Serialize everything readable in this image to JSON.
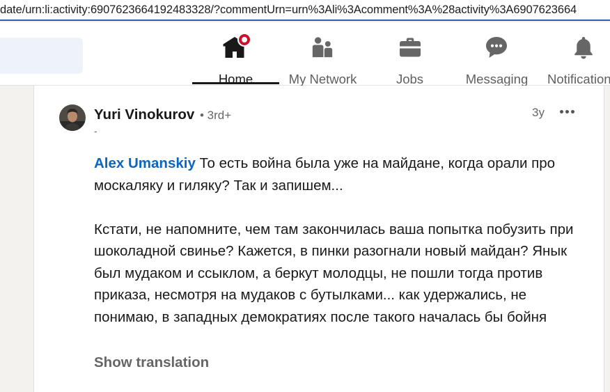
{
  "address_bar": {
    "url": "date/urn:li:activity:6907623664192483328/?commentUrn=urn%3Ali%3Acomment%3A%28activity%3A6907623664"
  },
  "nav": {
    "items": [
      {
        "label": "Home",
        "icon": "home-icon",
        "active": true,
        "notification": true
      },
      {
        "label": "My Network",
        "icon": "network-icon"
      },
      {
        "label": "Jobs",
        "icon": "briefcase-icon"
      },
      {
        "label": "Messaging",
        "icon": "message-icon"
      },
      {
        "label": "Notifications",
        "icon": "bell-icon"
      }
    ]
  },
  "comment": {
    "author": "Yuri Vinokurov",
    "degree": "• 3rd+",
    "headline": "-",
    "time": "3y",
    "mention": "Alex Umanskiy",
    "paragraph1": " То есть война была уже на майдане, когда орали про москаляку и гиляку? Так и запишем...",
    "paragraph2": "Кстати, не напомните, чем там закончилась ваша попытка побузить при шоколадной свинье? Кажется, в пинки разогнали новый майдан? Янык был мудаком и ссыклом, а беркут молодцы, не пошли тогда против приказа, несмотря на мудаков с бутылками... как удержались, не понимаю, в западных демократиях после такого началась бы бойня",
    "show_translation": "Show translation"
  },
  "colors": {
    "link": "#0a66c2",
    "badge": "#cb112d",
    "text": "#191919",
    "muted": "#666666"
  }
}
